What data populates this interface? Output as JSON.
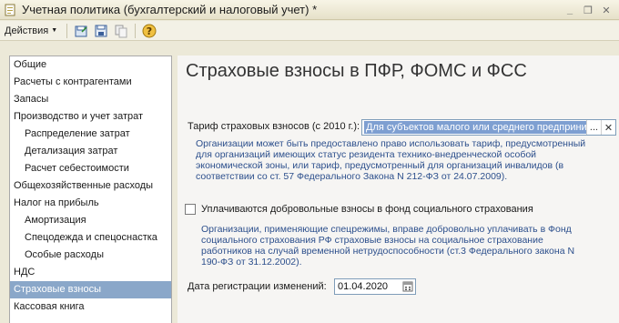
{
  "window": {
    "title": "Учетная политика (бухгалтерский и налоговый учет) *",
    "icon": "document-icon"
  },
  "toolbar": {
    "actions_label": "Действия",
    "buttons": [
      "save-write-icon",
      "save-close-icon",
      "copy-icon",
      "help-icon"
    ]
  },
  "sidebar": {
    "items": [
      {
        "label": "Общие",
        "level": 0,
        "selected": false
      },
      {
        "label": "Расчеты с контрагентами",
        "level": 0,
        "selected": false
      },
      {
        "label": "Запасы",
        "level": 0,
        "selected": false
      },
      {
        "label": "Производство и учет затрат",
        "level": 0,
        "selected": false
      },
      {
        "label": "Распределение затрат",
        "level": 1,
        "selected": false
      },
      {
        "label": "Детализация затрат",
        "level": 1,
        "selected": false
      },
      {
        "label": "Расчет себестоимости",
        "level": 1,
        "selected": false
      },
      {
        "label": "Общехозяйственные расходы",
        "level": 0,
        "selected": false
      },
      {
        "label": "Налог на прибыль",
        "level": 0,
        "selected": false
      },
      {
        "label": "Амортизация",
        "level": 1,
        "selected": false
      },
      {
        "label": "Спецодежда и спецоснастка",
        "level": 1,
        "selected": false
      },
      {
        "label": "Особые расходы",
        "level": 1,
        "selected": false
      },
      {
        "label": "НДС",
        "level": 0,
        "selected": false
      },
      {
        "label": "Страховые взносы",
        "level": 0,
        "selected": true
      },
      {
        "label": "Кассовая книга",
        "level": 0,
        "selected": false
      }
    ]
  },
  "main": {
    "title": "Страховые взносы в ПФР, ФОМС и ФСС",
    "tariff": {
      "label": "Тариф страховых взносов (с 2010 г.):",
      "value": "Для субъектов малого или среднего предпринимательства",
      "select_button": "...",
      "clear_button": "✕"
    },
    "tariff_note": [
      "Организации может быть предоставлено право использовать тариф, предусмотренный",
      "для организаций имеющих статус резидента технико-внедренческой особой",
      "экономической зоны, или тариф, предусмотренный для организаций инвалидов (в",
      "соответствии со ст. 57 Федерального Закона  N 212-ФЗ от 24.07.2009)."
    ],
    "voluntary": {
      "label": "Уплачиваются добровольные взносы в фонд социального страхования",
      "checked": false
    },
    "voluntary_note": [
      "Организации, применяющие спецрежимы, вправе добровольно уплачивать в Фонд",
      "социального страхования РФ страховые взносы на социальное страхование",
      "работников на случай временной нетрудоспособности (ст.3 Федерального закона N",
      "190-ФЗ от 31.12.2002)."
    ],
    "reg_date": {
      "label": "Дата регистрации изменений:",
      "value": "01.04.2020"
    }
  },
  "colors": {
    "selection": "#8aa7c9",
    "field_selection": "#7e9fd1",
    "note_text": "#2c4f8c",
    "panel_bg": "#f6f5f3"
  }
}
